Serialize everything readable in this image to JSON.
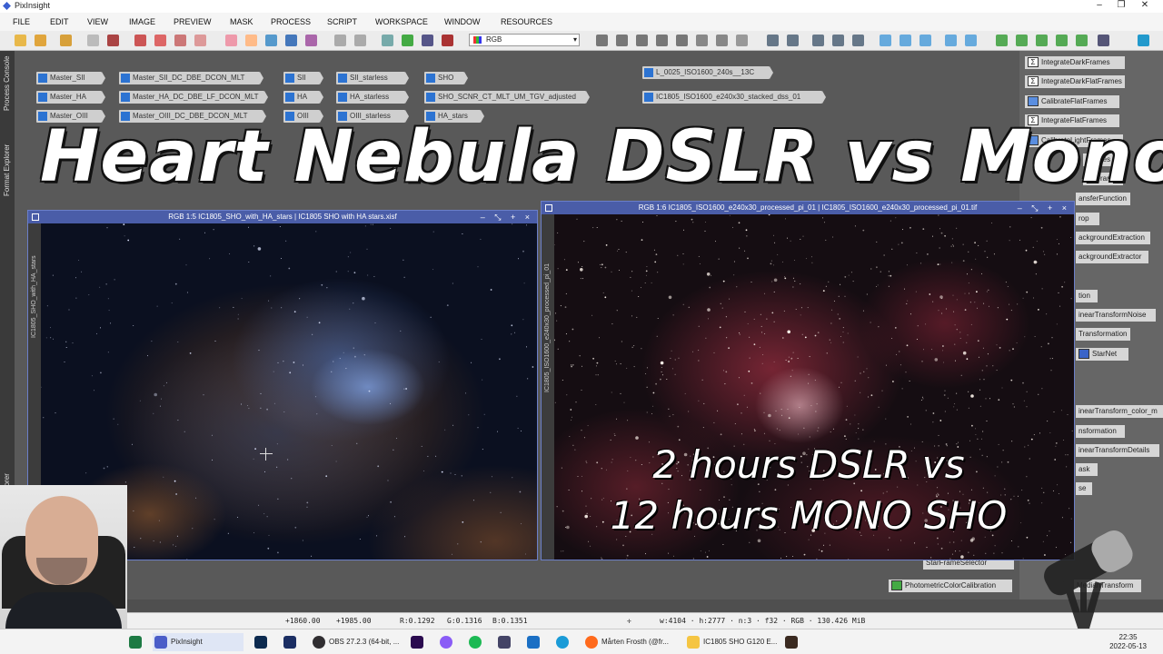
{
  "app": {
    "title": "PixInsight"
  },
  "menu": [
    "FILE",
    "EDIT",
    "VIEW",
    "IMAGE",
    "PREVIEW",
    "MASK",
    "PROCESS",
    "SCRIPT",
    "WORKSPACE",
    "WINDOW",
    "RESOURCES"
  ],
  "toolbar": {
    "color_mode": "RGB"
  },
  "left_dock": {
    "tabs": [
      "Process Console",
      "Format Explorer",
      "File Explorer"
    ]
  },
  "desktop_icons": [
    {
      "label": "Master_SII"
    },
    {
      "label": "Master_HA"
    },
    {
      "label": "Master_OIII"
    },
    {
      "label": "Master_SII_DC_DBE_DCON_MLT"
    },
    {
      "label": "Master_HA_DC_DBE_LF_DCON_MLT"
    },
    {
      "label": "Master_OIII_DC_DBE_DCON_MLT"
    },
    {
      "label": "SII"
    },
    {
      "label": "HA"
    },
    {
      "label": "OIII"
    },
    {
      "label": "SII_starless"
    },
    {
      "label": "HA_starless"
    },
    {
      "label": "OIII_starless"
    },
    {
      "label": "SHO"
    },
    {
      "label": "SHO_SCNR_CT_MLT_UM_TGV_adjusted"
    },
    {
      "label": "HA_stars"
    },
    {
      "label": "L_0025_ISO1600_240s__13C"
    },
    {
      "label": "IC1805_ISO1600_e240x30_stacked_dss_01"
    }
  ],
  "process_icons": [
    "IntegrateDarkFrames",
    "IntegrateDarkFlatFrames",
    "CalibrateFlatFrames",
    "IntegrateFlatFrames",
    "CalibrateLightFrames",
    "Frames",
    "ghtFrames",
    "ansferFunction",
    "rop",
    "ackgroundExtraction",
    "ackgroundExtractor",
    "tion",
    "inearTransformNoise",
    "Transformation",
    "StarNet",
    "inearTransform_color_m",
    "nsformation",
    "inearTransformDetails",
    "ask",
    "se",
    "StarFrameSelector",
    "PhotometricColorCalibration",
    "MedianTransform"
  ],
  "overlay": {
    "title": "Heart Nebula DSLR vs Mono",
    "caption_line1": "2 hours DSLR vs",
    "caption_line2": "12 hours MONO SHO"
  },
  "windows": {
    "left": {
      "title": "RGB 1:5 IC1805_SHO_with_HA_stars | IC1805 SHO with HA stars.xisf",
      "side": "IC1805_SHO_with_HA_stars",
      "buttons": "– ⤡ + ×"
    },
    "right": {
      "title": "RGB 1:6 IC1805_ISO1600_e240x30_processed_pi_01 | IC1805_ISO1600_e240x30_processed_pi_01.tif",
      "side": "IC1805_ISO1600_e240x30_processed_pi_01",
      "buttons": "– ⤡ + ×"
    }
  },
  "status": {
    "x": "+1860.00",
    "y": "+1985.00",
    "r": "R:0.1292",
    "g": "G:0.1316",
    "b": "B:0.1351",
    "info": "w:4104 · h:2777 · n:3 · f32 · RGB · 130.426 MiB"
  },
  "taskbar": {
    "items": [
      "PixInsight",
      "OBS 27.2.3 (64-bit, ...",
      "Mårten Frosth (@fr...",
      "IC1805 SHO G120 E..."
    ],
    "time": "22:35",
    "date": "2022-05-13"
  }
}
